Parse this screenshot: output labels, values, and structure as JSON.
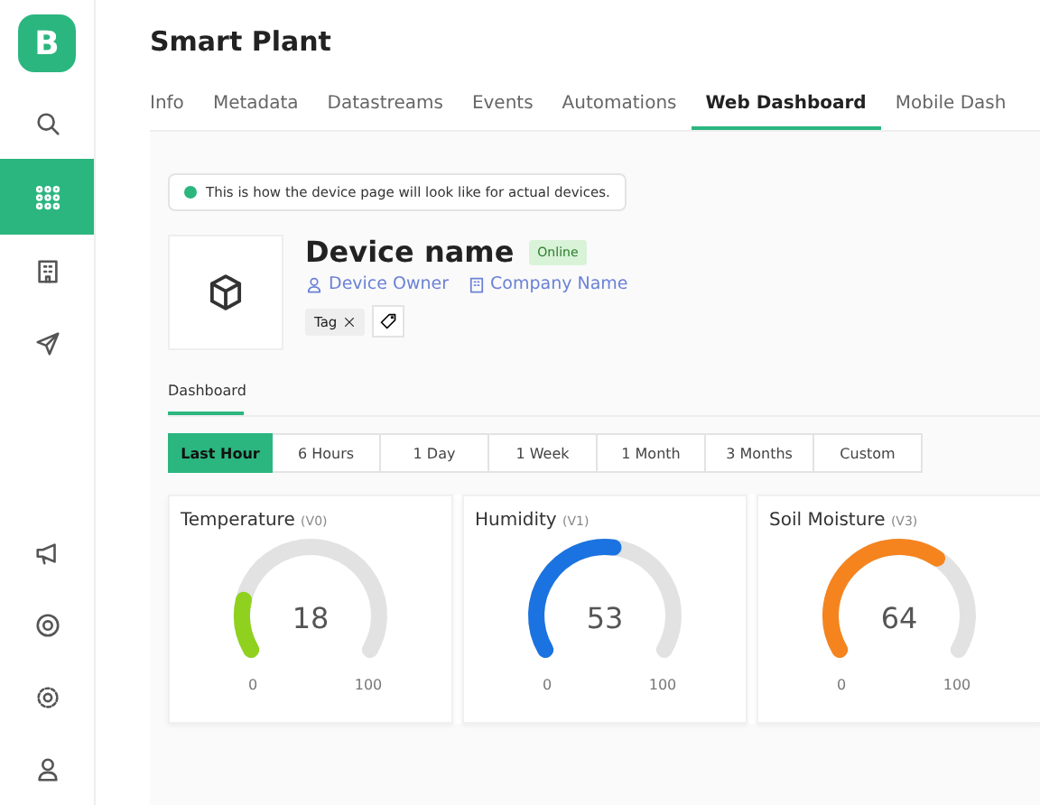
{
  "sidebar": {
    "logo": "B",
    "top_items": [
      {
        "selected": false
      },
      {
        "selected": true
      },
      {
        "selected": false
      },
      {
        "selected": false
      }
    ],
    "bottom_items": [
      {
        "selected": false
      },
      {
        "selected": false
      },
      {
        "selected": false
      },
      {
        "selected": false
      }
    ]
  },
  "header": {
    "title": "Smart Plant"
  },
  "tabs": [
    {
      "label": "Info",
      "selected": false
    },
    {
      "label": "Metadata",
      "selected": false
    },
    {
      "label": "Datastreams",
      "selected": false
    },
    {
      "label": "Events",
      "selected": false
    },
    {
      "label": "Automations",
      "selected": false
    },
    {
      "label": "Web Dashboard",
      "selected": true
    },
    {
      "label": "Mobile Dash",
      "selected": false
    }
  ],
  "notice": {
    "text": "This is how the device page will look like for actual devices."
  },
  "device": {
    "name": "Device name",
    "status": "Online",
    "owner": "Device Owner",
    "company": "Company Name",
    "tags": [
      "Tag"
    ]
  },
  "subtabs": [
    {
      "label": "Dashboard",
      "selected": true
    }
  ],
  "time_ranges": [
    {
      "label": "Last Hour",
      "selected": true
    },
    {
      "label": "6 Hours",
      "selected": false
    },
    {
      "label": "1 Day",
      "selected": false
    },
    {
      "label": "1 Week",
      "selected": false
    },
    {
      "label": "1 Month",
      "selected": false
    },
    {
      "label": "3 Months",
      "selected": false
    },
    {
      "label": "Custom",
      "selected": false
    }
  ],
  "gauges": [
    {
      "title": "Temperature",
      "pin": "(V0)",
      "value": "18",
      "color": "#8fd11e",
      "min": "0",
      "max": "100"
    },
    {
      "title": "Humidity",
      "pin": "(V1)",
      "value": "53",
      "color": "#1a73e0",
      "min": "0",
      "max": "100"
    },
    {
      "title": "Soil Moisture",
      "pin": "(V3)",
      "value": "64",
      "color": "#f5841f",
      "min": "0",
      "max": "100"
    }
  ]
}
